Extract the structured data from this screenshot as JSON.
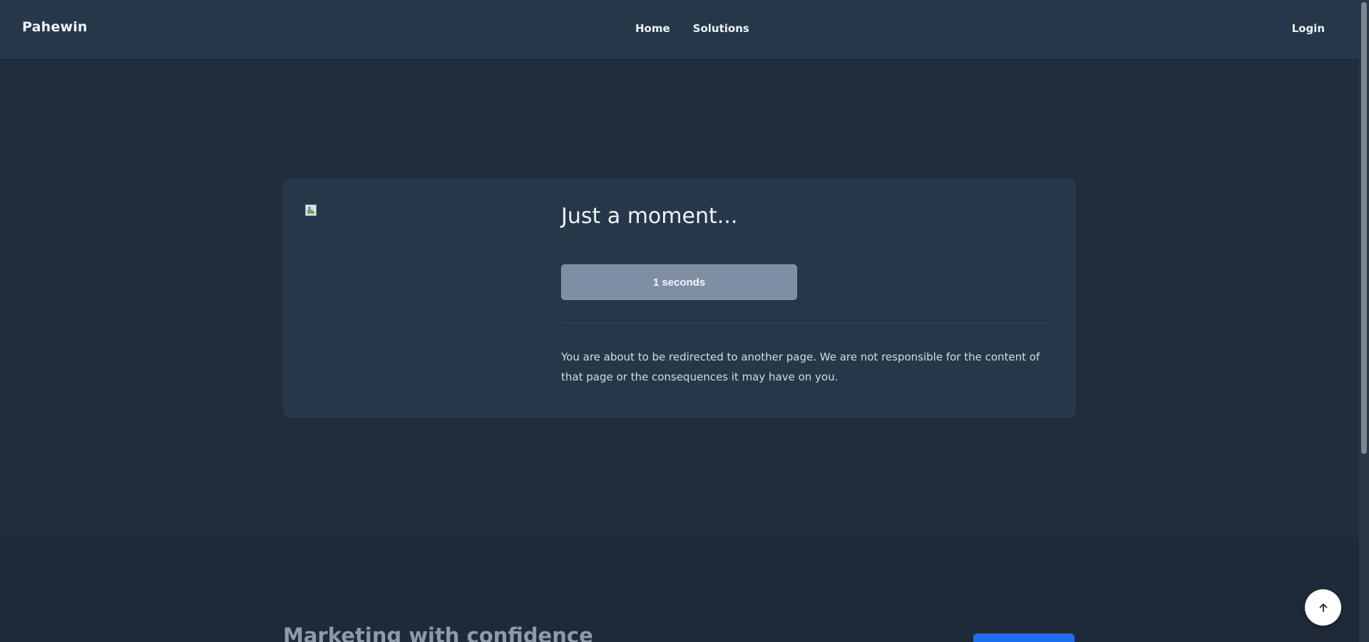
{
  "navbar": {
    "brand": "Pahewin",
    "links": [
      "Home",
      "Solutions"
    ],
    "login": "Login"
  },
  "card": {
    "image_icon": "broken-image-icon",
    "title": "Just a moment...",
    "countdown_label": "1 seconds",
    "notice": "You are about to be redirected to another page. We are not responsible for the content of that page or the consequences it may have on you."
  },
  "lower_section": {
    "heading": "Marketing with confidence"
  },
  "back_to_top": {
    "icon": "arrow-up-icon"
  },
  "colors": {
    "background": "#212d3d",
    "navbar": "#26374a",
    "card": "#26374a",
    "countdown_button": "#808ea3",
    "accent_blue": "#1a6ef5"
  }
}
